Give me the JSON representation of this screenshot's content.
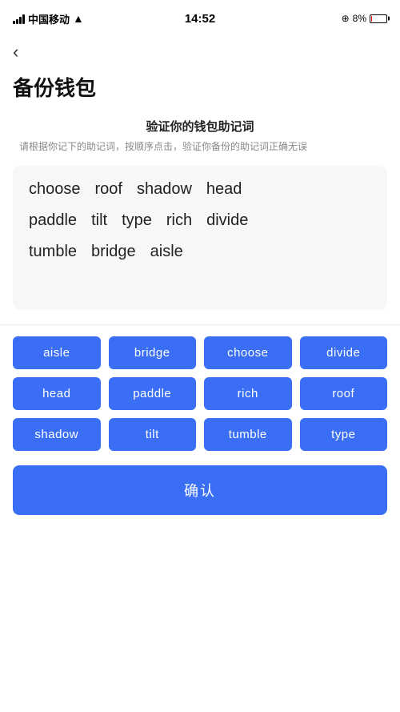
{
  "statusBar": {
    "carrier": "中国移动",
    "time": "14:52",
    "battery": "8%"
  },
  "header": {
    "back_label": "‹",
    "title": "备份钱包"
  },
  "section": {
    "title": "验证你的钱包助记词",
    "desc": "请根据你记下的助记词，按顺序点击，验证你备份的助记词正确无误"
  },
  "wordGridRows": [
    [
      "choose",
      "roof",
      "shadow",
      "head"
    ],
    [
      "paddle",
      "tilt",
      "type",
      "rich",
      "divide"
    ],
    [
      "tumble",
      "bridge",
      "aisle"
    ]
  ],
  "wordButtons": [
    "aisle",
    "bridge",
    "choose",
    "divide",
    "head",
    "paddle",
    "rich",
    "roof",
    "shadow",
    "tilt",
    "tumble",
    "type"
  ],
  "confirmButton": {
    "label": "确认"
  }
}
